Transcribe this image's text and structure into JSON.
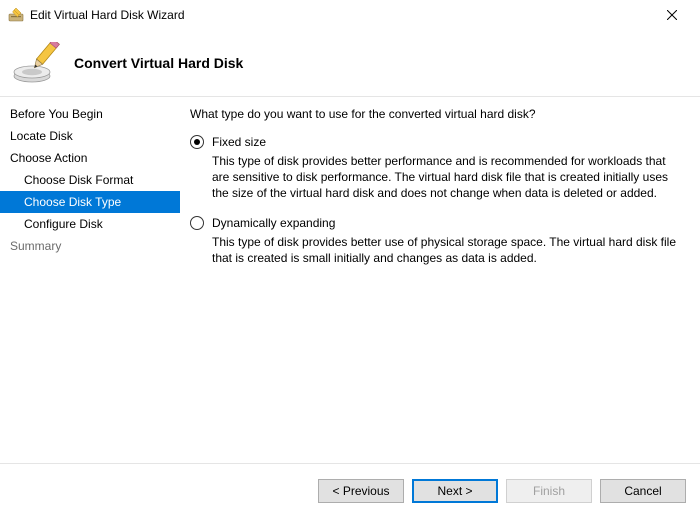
{
  "window": {
    "title": "Edit Virtual Hard Disk Wizard"
  },
  "header": {
    "title": "Convert Virtual Hard Disk"
  },
  "sidebar": {
    "items": [
      {
        "label": "Before You Begin"
      },
      {
        "label": "Locate Disk"
      },
      {
        "label": "Choose Action"
      },
      {
        "label": "Choose Disk Format"
      },
      {
        "label": "Choose Disk Type"
      },
      {
        "label": "Configure Disk"
      },
      {
        "label": "Summary"
      }
    ]
  },
  "content": {
    "question": "What type do you want to use for the converted virtual hard disk?",
    "options": [
      {
        "label": "Fixed size",
        "desc": "This type of disk provides better performance and is recommended for workloads that are sensitive to disk performance. The virtual hard disk file that is created initially uses the size of the virtual hard disk and does not change when data is deleted or added."
      },
      {
        "label": "Dynamically expanding",
        "desc": "This type of disk provides better use of physical storage space. The virtual hard disk file that is created is small initially and changes as data is added."
      }
    ]
  },
  "footer": {
    "previous": "< Previous",
    "next": "Next >",
    "finish": "Finish",
    "cancel": "Cancel"
  }
}
